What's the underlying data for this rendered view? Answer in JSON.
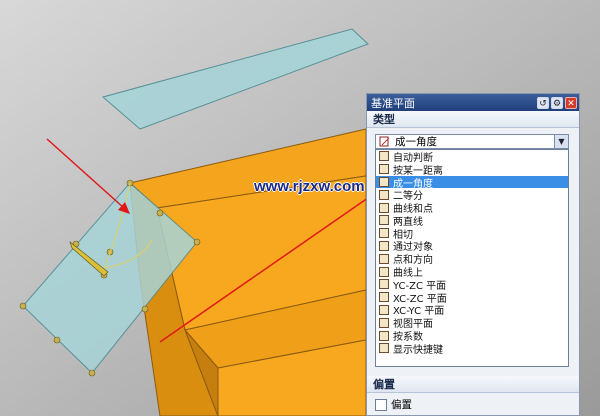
{
  "dialog": {
    "title": "基准平面",
    "type_section": "类型",
    "selected_type": "成一角度",
    "options": [
      "自动判断",
      "按某一距离",
      "成一角度",
      "二等分",
      "曲线和点",
      "两直线",
      "相切",
      "通过对象",
      "点和方向",
      "曲线上",
      "YC-ZC 平面",
      "XC-ZC 平面",
      "XC-YC 平面",
      "视图平面",
      "按系数",
      "显示快捷键"
    ],
    "selected_index": 2,
    "offset_section": "偏置",
    "offset_checkbox": "偏置"
  },
  "watermark": "www.rjzxw.com",
  "colors": {
    "background": "#b8b8b8",
    "solid_face": "#f0a01a",
    "plane": "#a7d4d8",
    "highlight": "#3a8ee6",
    "arrow": "#e01818"
  }
}
